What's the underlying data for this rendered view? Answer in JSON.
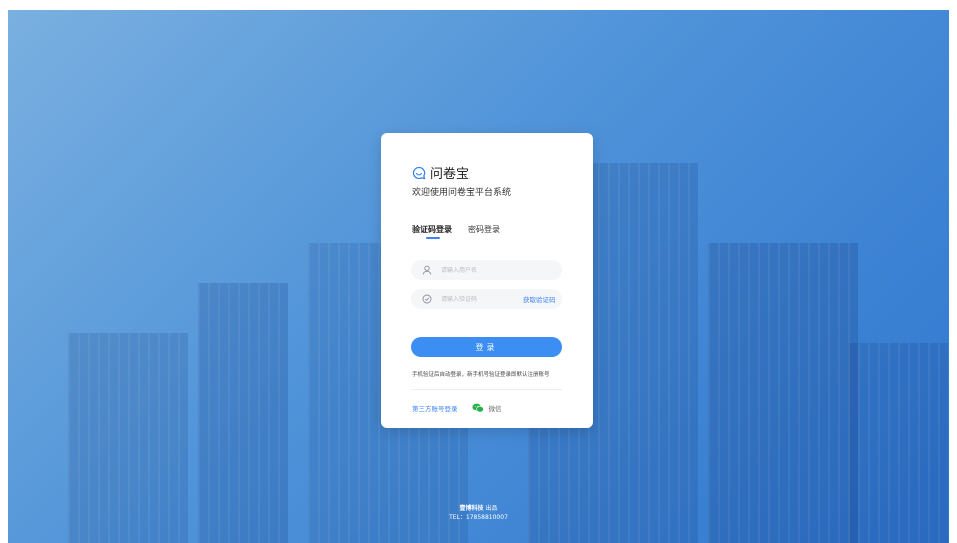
{
  "brand": {
    "name": "问卷宝",
    "logo_icon": "speech-bubble-icon"
  },
  "subtitle": "欢迎使用问卷宝平台系统",
  "tabs": [
    {
      "label": "验证码登录",
      "active": true
    },
    {
      "label": "密码登录",
      "active": false
    }
  ],
  "username_field": {
    "placeholder": "请输入用户名",
    "value": "",
    "icon": "user-icon"
  },
  "code_field": {
    "placeholder": "请输入验证码",
    "value": "",
    "icon": "shield-check-icon",
    "action_label": "获取验证码"
  },
  "login_button": "登录",
  "notice": "手机验证后自动登录，新手机号验证登录即默认注册账号",
  "third_party": {
    "label": "第三方账号登录",
    "wechat_label": "微信",
    "wechat_icon": "wechat-icon"
  },
  "footer": {
    "company": "壹博科技",
    "company_suffix": "出品",
    "tel": "TEL：17858810007"
  },
  "colors": {
    "accent": "#3c8ef3",
    "link": "#3b82f6",
    "wechat": "#22b14c"
  }
}
